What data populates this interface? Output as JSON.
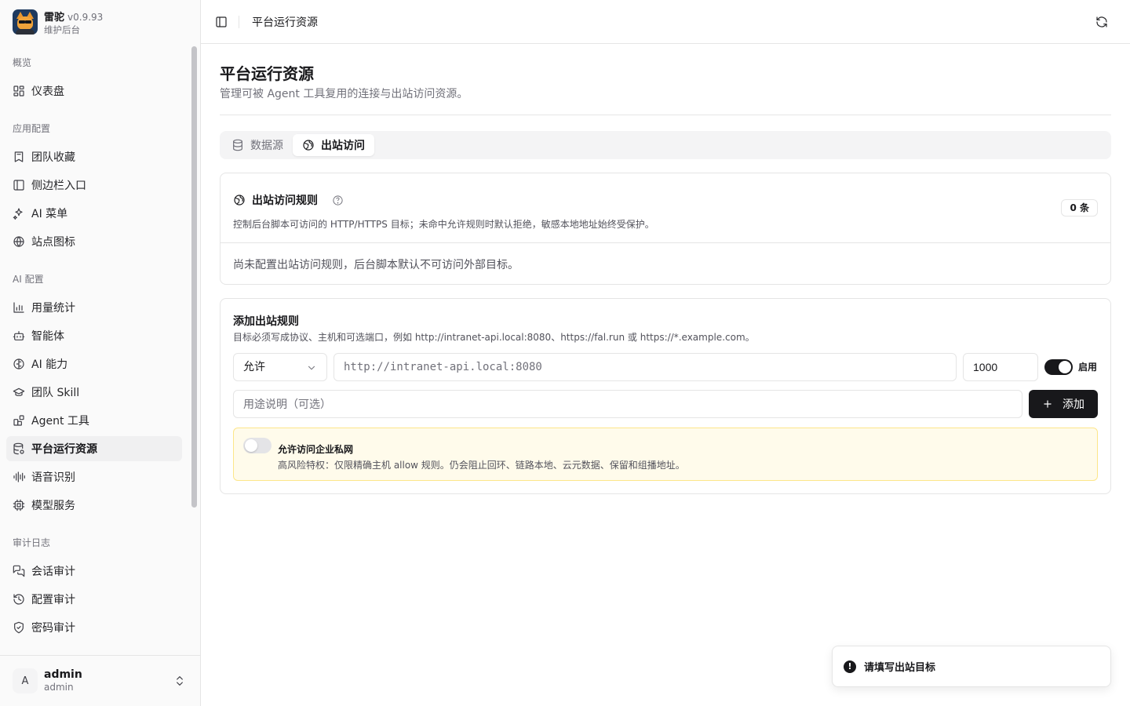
{
  "brand": {
    "name": "雷驼",
    "version": "v0.9.93",
    "subtitle": "维护后台",
    "logo_icon": "camel-mascot-logo"
  },
  "sidebar": {
    "groups": [
      {
        "label": "概览",
        "items": [
          {
            "label": "仪表盘",
            "icon": "dashboard-icon"
          }
        ]
      },
      {
        "label": "应用配置",
        "items": [
          {
            "label": "团队收藏",
            "icon": "bookmark-icon"
          },
          {
            "label": "侧边栏入口",
            "icon": "sidebar-icon"
          },
          {
            "label": "AI 菜单",
            "icon": "sparkle-icon"
          },
          {
            "label": "站点图标",
            "icon": "globe-icon"
          }
        ]
      },
      {
        "label": "AI 配置",
        "items": [
          {
            "label": "用量统计",
            "icon": "bar-chart-icon"
          },
          {
            "label": "智能体",
            "icon": "bot-icon"
          },
          {
            "label": "AI 能力",
            "icon": "brain-icon"
          },
          {
            "label": "团队 Skill",
            "icon": "graduation-cap-icon"
          },
          {
            "label": "Agent 工具",
            "icon": "blocks-icon"
          },
          {
            "label": "平台运行资源",
            "icon": "database-cog-icon",
            "active": true
          },
          {
            "label": "语音识别",
            "icon": "audio-waveform-icon"
          },
          {
            "label": "模型服务",
            "icon": "cpu-icon"
          }
        ]
      },
      {
        "label": "审计日志",
        "items": [
          {
            "label": "会话审计",
            "icon": "chat-icon"
          },
          {
            "label": "配置审计",
            "icon": "history-icon"
          },
          {
            "label": "密码审计",
            "icon": "shield-icon"
          }
        ]
      }
    ]
  },
  "user": {
    "initial": "A",
    "name": "admin",
    "role": "admin"
  },
  "header": {
    "title": "平台运行资源"
  },
  "page": {
    "title": "平台运行资源",
    "description": "管理可被 Agent 工具复用的连接与出站访问资源。"
  },
  "tabs": [
    {
      "label": "数据源",
      "icon": "database-icon",
      "active": false
    },
    {
      "label": "出站访问",
      "icon": "globe-icon",
      "active": true
    }
  ],
  "rules": {
    "title": "出站访问规则",
    "description": "控制后台脚本可访问的 HTTP/HTTPS 目标；未命中允许规则时默认拒绝，敏感本地地址始终受保护。",
    "count": "0 条",
    "empty": "尚未配置出站访问规则，后台脚本默认不可访问外部目标。"
  },
  "add_rule": {
    "title": "添加出站规则",
    "description": "目标必须写成协议、主机和可选端口，例如 http://intranet-api.local:8080、https://fal.run 或 https://*.example.com。",
    "action_value": "允许",
    "target_placeholder": "http://intranet-api.local:8080",
    "priority_value": "1000",
    "enabled_label": "启用",
    "enabled": true,
    "purpose_placeholder": "用途说明（可选）",
    "add_label": "添加"
  },
  "private_network": {
    "title": "允许访问企业私网",
    "description": "高风险特权：仅限精确主机 allow 规则。仍会阻止回环、链路本地、云元数据、保留和组播地址。",
    "enabled": false
  },
  "toast": {
    "message": "请填写出站目标",
    "icon": "alert-circle-icon"
  },
  "colors": {
    "primary": "#18181b",
    "muted": "#71717a",
    "border": "#e5e5e5",
    "warning_bg": "#fffbeb",
    "warning_border": "#fde68a"
  }
}
